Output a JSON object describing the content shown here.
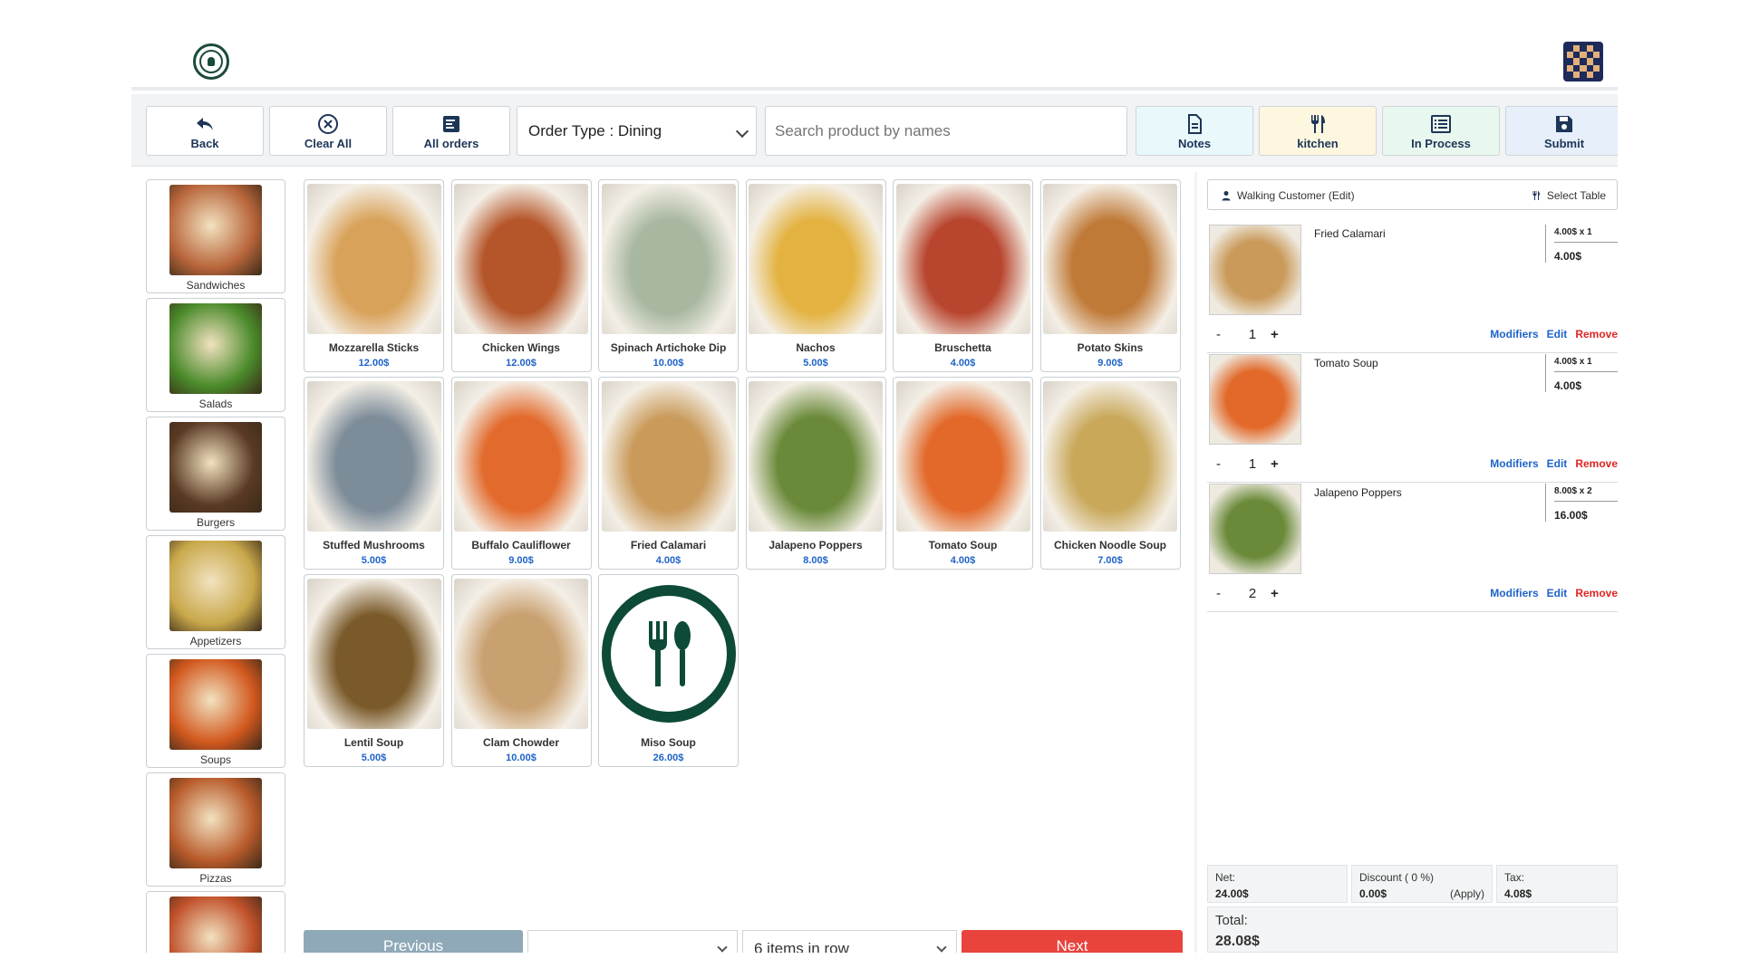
{
  "toolbar": {
    "back_label": "Back",
    "clear_label": "Clear All",
    "orders_label": "All orders",
    "order_type": "Order Type : Dining",
    "search_placeholder": "Search product by names",
    "notes_label": "Notes",
    "kitchen_label": "kitchen",
    "in_process_label": "In Process",
    "submit_label": "Submit"
  },
  "categories": [
    {
      "label": "Sandwiches",
      "color": "#b8653a"
    },
    {
      "label": "Salads",
      "color": "#4a8a2a"
    },
    {
      "label": "Burgers",
      "color": "#5a3a24"
    },
    {
      "label": "Appetizers",
      "color": "#c8a84a"
    },
    {
      "label": "Soups",
      "color": "#d2581e"
    },
    {
      "label": "Pizzas",
      "color": "#b85a2a"
    },
    {
      "label": "",
      "color": "#c0502a"
    }
  ],
  "products": [
    {
      "name": "Mozzarella Sticks",
      "price": "12.00$",
      "color": "#d9a25a"
    },
    {
      "name": "Chicken Wings",
      "price": "12.00$",
      "color": "#b5562a"
    },
    {
      "name": "Spinach Artichoke Dip",
      "price": "10.00$",
      "color": "#a8b7a0"
    },
    {
      "name": "Nachos",
      "price": "5.00$",
      "color": "#e3b240"
    },
    {
      "name": "Bruschetta",
      "price": "4.00$",
      "color": "#b8452e"
    },
    {
      "name": "Potato Skins",
      "price": "9.00$",
      "color": "#c07a38"
    },
    {
      "name": "Stuffed Mushrooms",
      "price": "5.00$",
      "color": "#7d8c99"
    },
    {
      "name": "Buffalo Cauliflower",
      "price": "9.00$",
      "color": "#e26a2c"
    },
    {
      "name": "Fried Calamari",
      "price": "4.00$",
      "color": "#c99a5a"
    },
    {
      "name": "Jalapeno Poppers",
      "price": "8.00$",
      "color": "#6a8a3a"
    },
    {
      "name": "Tomato Soup",
      "price": "4.00$",
      "color": "#e2692a"
    },
    {
      "name": "Chicken Noodle Soup",
      "price": "7.00$",
      "color": "#c9a85a"
    },
    {
      "name": "Lentil Soup",
      "price": "5.00$",
      "color": "#7a5a2a"
    },
    {
      "name": "Clam Chowder",
      "price": "10.00$",
      "color": "#c9a070"
    },
    {
      "name": "Miso Soup",
      "price": "26.00$",
      "color": "#0d4a38"
    }
  ],
  "pager": {
    "previous_label": "Previous",
    "items_per_row": "6 items in row",
    "next_label": "Next"
  },
  "cart": {
    "customer": "Walking Customer (Edit)",
    "select_table": "Select Table",
    "lines": [
      {
        "name": "Fried Calamari",
        "unit": "4.00$ x 1",
        "total": "4.00$",
        "qty": "1",
        "color": "#c99a5a"
      },
      {
        "name": "Tomato Soup",
        "unit": "4.00$ x 1",
        "total": "4.00$",
        "qty": "1",
        "color": "#e2692a"
      },
      {
        "name": "Jalapeno Poppers",
        "unit": "8.00$ x 2",
        "total": "16.00$",
        "qty": "2",
        "color": "#6a8a3a"
      }
    ],
    "minus": "-",
    "plus": "+",
    "modifiers_label": "Modifiers",
    "edit_label": "Edit",
    "remove_label": "Remove",
    "net_label": "Net:",
    "net_value": "24.00$",
    "discount_label": "Discount ( 0 %)",
    "discount_value": "0.00$",
    "apply_label": "(Apply)",
    "tax_label": "Tax:",
    "tax_value": "4.08$",
    "total_label": "Total:",
    "total_value": "28.08$"
  }
}
